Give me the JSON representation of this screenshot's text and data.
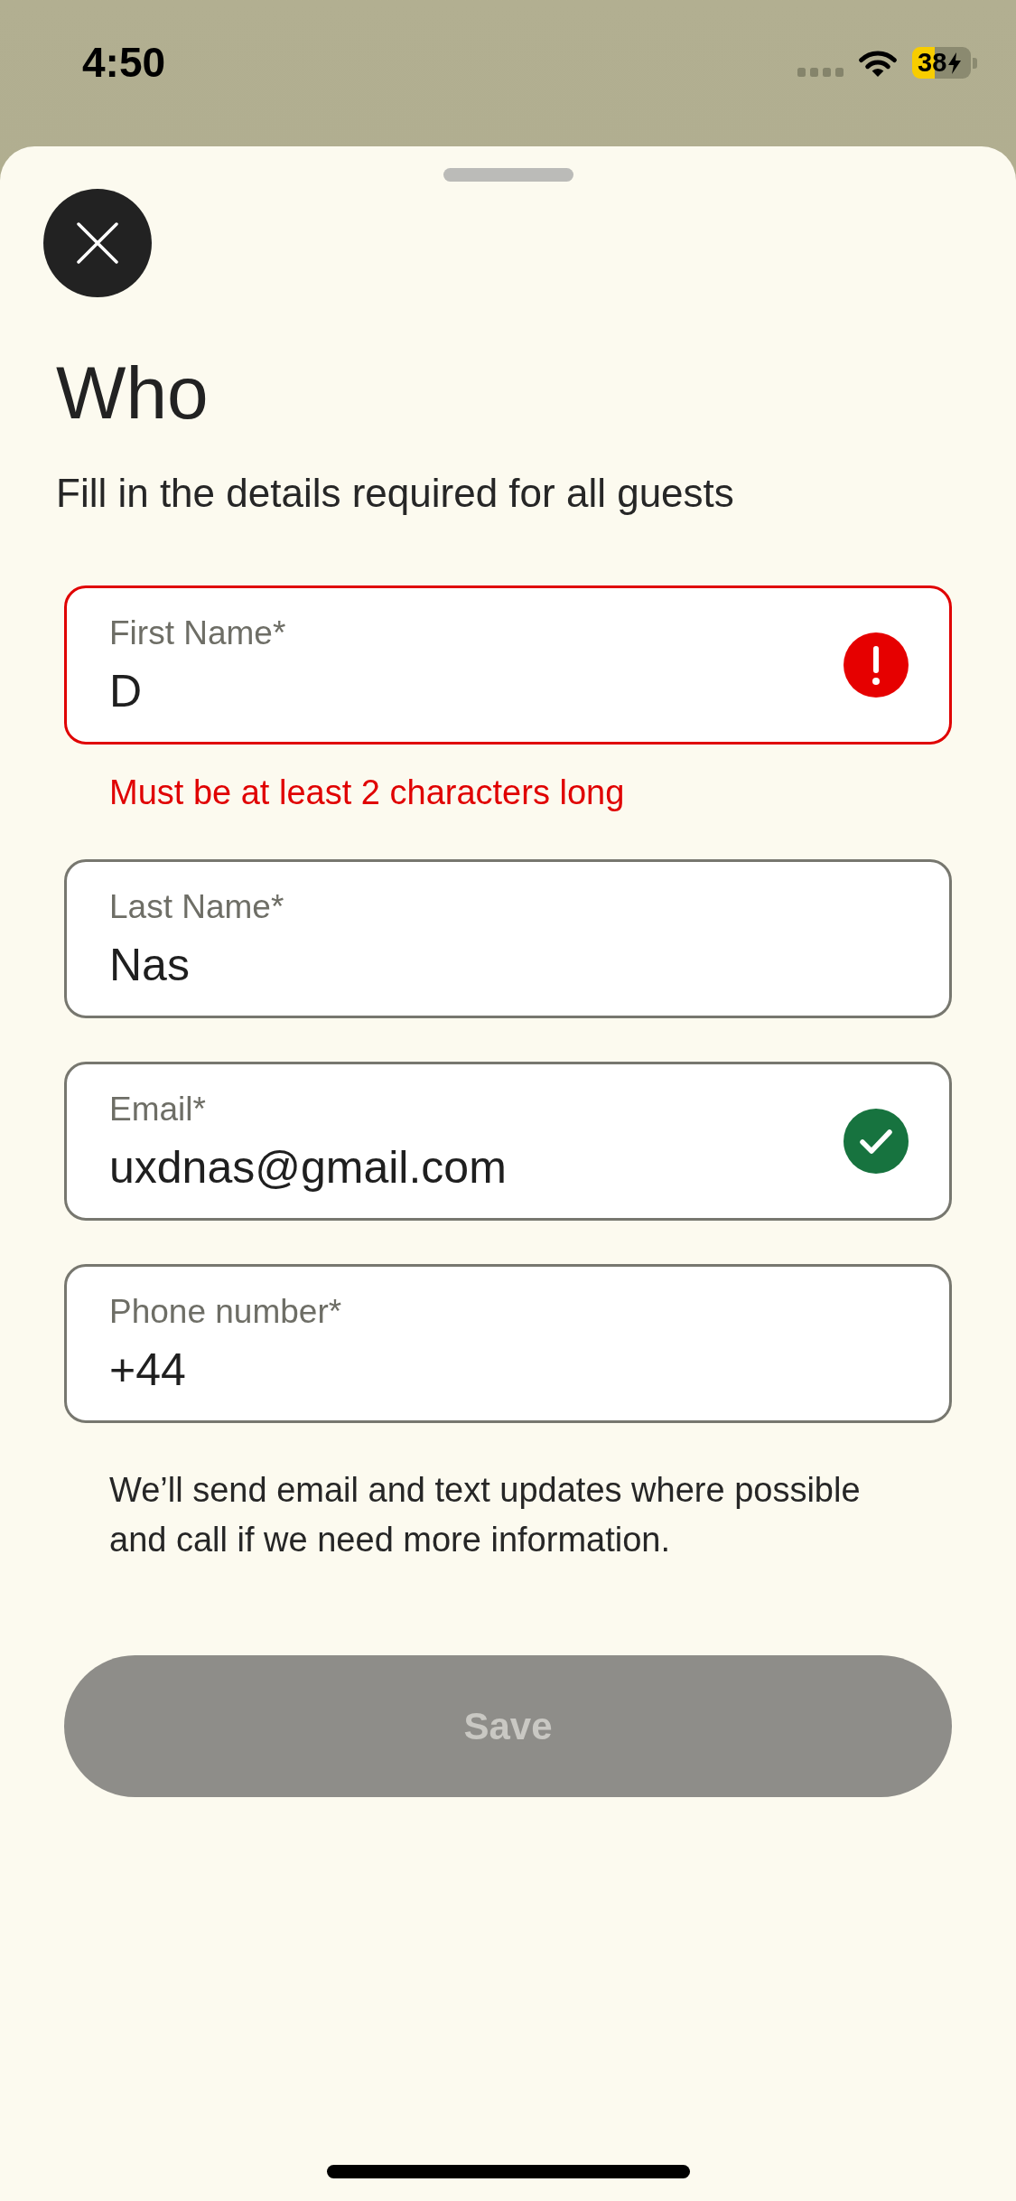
{
  "status_bar": {
    "time": "4:50",
    "battery": "38"
  },
  "sheet": {
    "title": "Who",
    "subtitle": "Fill in the details required for all guests"
  },
  "fields": [
    {
      "label": "First Name*",
      "value": "D",
      "has_error": true,
      "validated": false,
      "error": "Must be at least 2 characters long"
    },
    {
      "label": "Last Name*",
      "value": "Nas",
      "has_error": false,
      "validated": false
    },
    {
      "label": "Email*",
      "value": "uxdnas@gmail.com",
      "has_error": false,
      "validated": true
    },
    {
      "label": "Phone number*",
      "value": "+44",
      "has_error": false,
      "validated": false
    }
  ],
  "note": "We’ll send email and text updates where possible and call if we need more information.",
  "save_button": {
    "label": "Save",
    "disabled": true
  }
}
